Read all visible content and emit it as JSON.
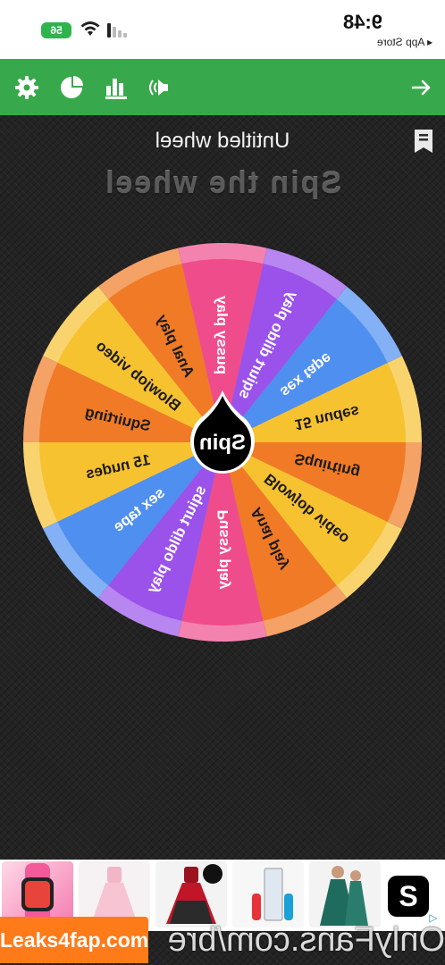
{
  "status_bar": {
    "time": "9:48",
    "back_link": "◂ App Store",
    "battery": "56"
  },
  "toolbar": {
    "icons": [
      "gear-icon",
      "pie-chart-icon",
      "bar-chart-icon",
      "sound-icon",
      "arrow-right-icon"
    ]
  },
  "wheel": {
    "title": "Untitled wheel",
    "heading": "Spin the wheel",
    "center_label": "Spin",
    "slices": [
      {
        "label": "pussy play",
        "color": "#ef4c8c"
      },
      {
        "label": "Anal play",
        "color": "#f07a26"
      },
      {
        "label": "Blowjob video",
        "color": "#f7c230"
      },
      {
        "label": "Squirting",
        "color": "#f07a26"
      },
      {
        "label": "15 nudes",
        "color": "#f7c230"
      },
      {
        "label": "sex tape",
        "color": "#4f8ff0"
      },
      {
        "label": "sqiurt dildo play",
        "color": "#9a52ea"
      },
      {
        "label": "Pussy play",
        "color": "#ef4c8c"
      },
      {
        "label": "Anal play",
        "color": "#f07a26"
      },
      {
        "label": "Blowjob video",
        "color": "#f7c230"
      },
      {
        "label": "Squirting",
        "color": "#f07a26"
      },
      {
        "label": "15 nudes",
        "color": "#f7c230"
      },
      {
        "label": "sex tape",
        "color": "#4f8ff0"
      },
      {
        "label": "sqiurt dildo play",
        "color": "#9a52ea"
      }
    ]
  },
  "ad": {
    "close_icon": "ad-choices-icon",
    "brand_letter": "S"
  },
  "watermark": {
    "label": "Leaks4fap.com",
    "overlay_text": "OnlyFans.com/bre"
  }
}
